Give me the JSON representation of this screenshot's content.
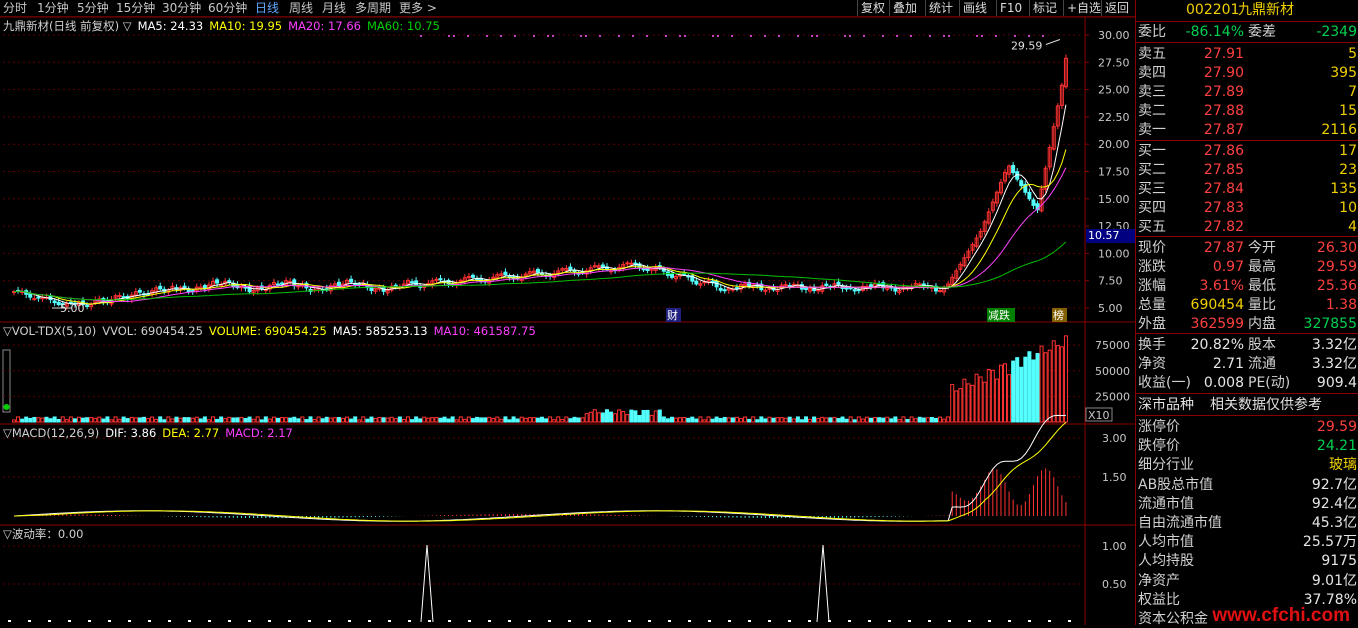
{
  "toolbar": {
    "periods": [
      "分时",
      "1分钟",
      "5分钟",
      "15分钟",
      "30分钟",
      "60分钟",
      "日线",
      "周线",
      "月线",
      "多周期",
      "更多 >"
    ],
    "active_period": "日线",
    "buttons": [
      "复权",
      "叠加",
      "统计",
      "画线",
      "F10",
      "标记",
      "+自选",
      "返回"
    ]
  },
  "main_panel": {
    "title": "九鼎新材(日线 前复权) ▽",
    "ma5": "MA5: 24.33",
    "ma10": "MA10: 19.95",
    "ma20": "MA20: 17.66",
    "ma60": "MA60: 10.75",
    "high_label": "29.59",
    "low_label": "5.00",
    "current_price_tag": "10.57",
    "y_ticks": [
      "30.00",
      "27.50",
      "25.00",
      "22.50",
      "20.00",
      "17.50",
      "15.00",
      "12.50",
      "10.00",
      "7.50",
      "5.00"
    ],
    "event_markers": [
      "财",
      "减跌",
      "榜"
    ]
  },
  "vol_panel": {
    "title": "▽VOL-TDX(5,10)",
    "vvol": "VVOL: 690454.25",
    "volume": "VOLUME: 690454.25",
    "ma5": "MA5: 585253.13",
    "ma10": "MA10: 461587.75",
    "y_ticks": [
      "75000",
      "50000",
      "25000"
    ],
    "unit": "X10"
  },
  "macd_panel": {
    "title": "▽MACD(12,26,9)",
    "dif": "DIF: 3.86",
    "dea": "DEA: 2.77",
    "macd": "MACD: 2.17",
    "y_ticks": [
      "3.00",
      "1.50"
    ]
  },
  "vola_panel": {
    "title": "▽波动率：0.00",
    "y_ticks": [
      "1.00",
      "0.50"
    ]
  },
  "quote": {
    "code": "002201",
    "name": "九鼎新材",
    "weibi_label": "委比",
    "weibi": "-86.14%",
    "weicha_label": "委差",
    "weicha": "-2349",
    "asks": [
      {
        "label": "卖五",
        "price": "27.91",
        "vol": "5"
      },
      {
        "label": "卖四",
        "price": "27.90",
        "vol": "395"
      },
      {
        "label": "卖三",
        "price": "27.89",
        "vol": "7"
      },
      {
        "label": "卖二",
        "price": "27.88",
        "vol": "15"
      },
      {
        "label": "卖一",
        "price": "27.87",
        "vol": "2116"
      }
    ],
    "bids": [
      {
        "label": "买一",
        "price": "27.86",
        "vol": "17"
      },
      {
        "label": "买二",
        "price": "27.85",
        "vol": "23"
      },
      {
        "label": "买三",
        "price": "27.84",
        "vol": "135"
      },
      {
        "label": "买四",
        "price": "27.83",
        "vol": "10"
      },
      {
        "label": "买五",
        "price": "27.82",
        "vol": "4"
      }
    ],
    "stats": [
      {
        "l1": "现价",
        "v1": "27.87",
        "c1": "red",
        "l2": "今开",
        "v2": "26.30",
        "c2": "red"
      },
      {
        "l1": "涨跌",
        "v1": "0.97",
        "c1": "red",
        "l2": "最高",
        "v2": "29.59",
        "c2": "red"
      },
      {
        "l1": "涨幅",
        "v1": "3.61%",
        "c1": "red",
        "l2": "最低",
        "v2": "25.36",
        "c2": "red"
      },
      {
        "l1": "总量",
        "v1": "690454",
        "c1": "yel",
        "l2": "量比",
        "v2": "1.38",
        "c2": "red"
      },
      {
        "l1": "外盘",
        "v1": "362599",
        "c1": "red",
        "l2": "内盘",
        "v2": "327855",
        "c2": "grn"
      }
    ],
    "fin": [
      {
        "l1": "换手",
        "v1": "20.82%",
        "l2": "股本",
        "v2": "3.32亿"
      },
      {
        "l1": "净资",
        "v1": "2.71",
        "l2": "流通",
        "v2": "3.32亿"
      },
      {
        "l1": "收益(一)",
        "v1": "0.008",
        "l2": "PE(动)",
        "v2": "909.4"
      }
    ],
    "market_tab": "深市品种",
    "notice": "相关数据仅供参考",
    "info": [
      {
        "l": "涨停价",
        "v": "29.59",
        "c": "red"
      },
      {
        "l": "跌停价",
        "v": "24.21",
        "c": "grn"
      },
      {
        "l": "细分行业",
        "v": "玻璃",
        "c": "yel"
      },
      {
        "l": "AB股总市值",
        "v": "92.7亿",
        "c": "wht"
      },
      {
        "l": "流通市值",
        "v": "92.4亿",
        "c": "wht"
      },
      {
        "l": "自由流通市值",
        "v": "45.3亿",
        "c": "wht"
      },
      {
        "l": "人均市值",
        "v": "25.57万",
        "c": "wht"
      },
      {
        "l": "人均持股",
        "v": "9175",
        "c": "wht"
      },
      {
        "l": "净资产",
        "v": "9.01亿",
        "c": "wht"
      },
      {
        "l": "权益比",
        "v": "37.78%",
        "c": "wht"
      },
      {
        "l": "资本公积金",
        "v": "",
        "c": "wht"
      }
    ]
  },
  "watermark": "www.cfchi.com",
  "colors": {
    "up": "#ff3232",
    "down": "#54ffff",
    "ma5": "#ffffff",
    "ma10": "#ffff00",
    "ma20": "#ff40ff",
    "ma60": "#00c000",
    "grid": "#5a0000"
  }
}
